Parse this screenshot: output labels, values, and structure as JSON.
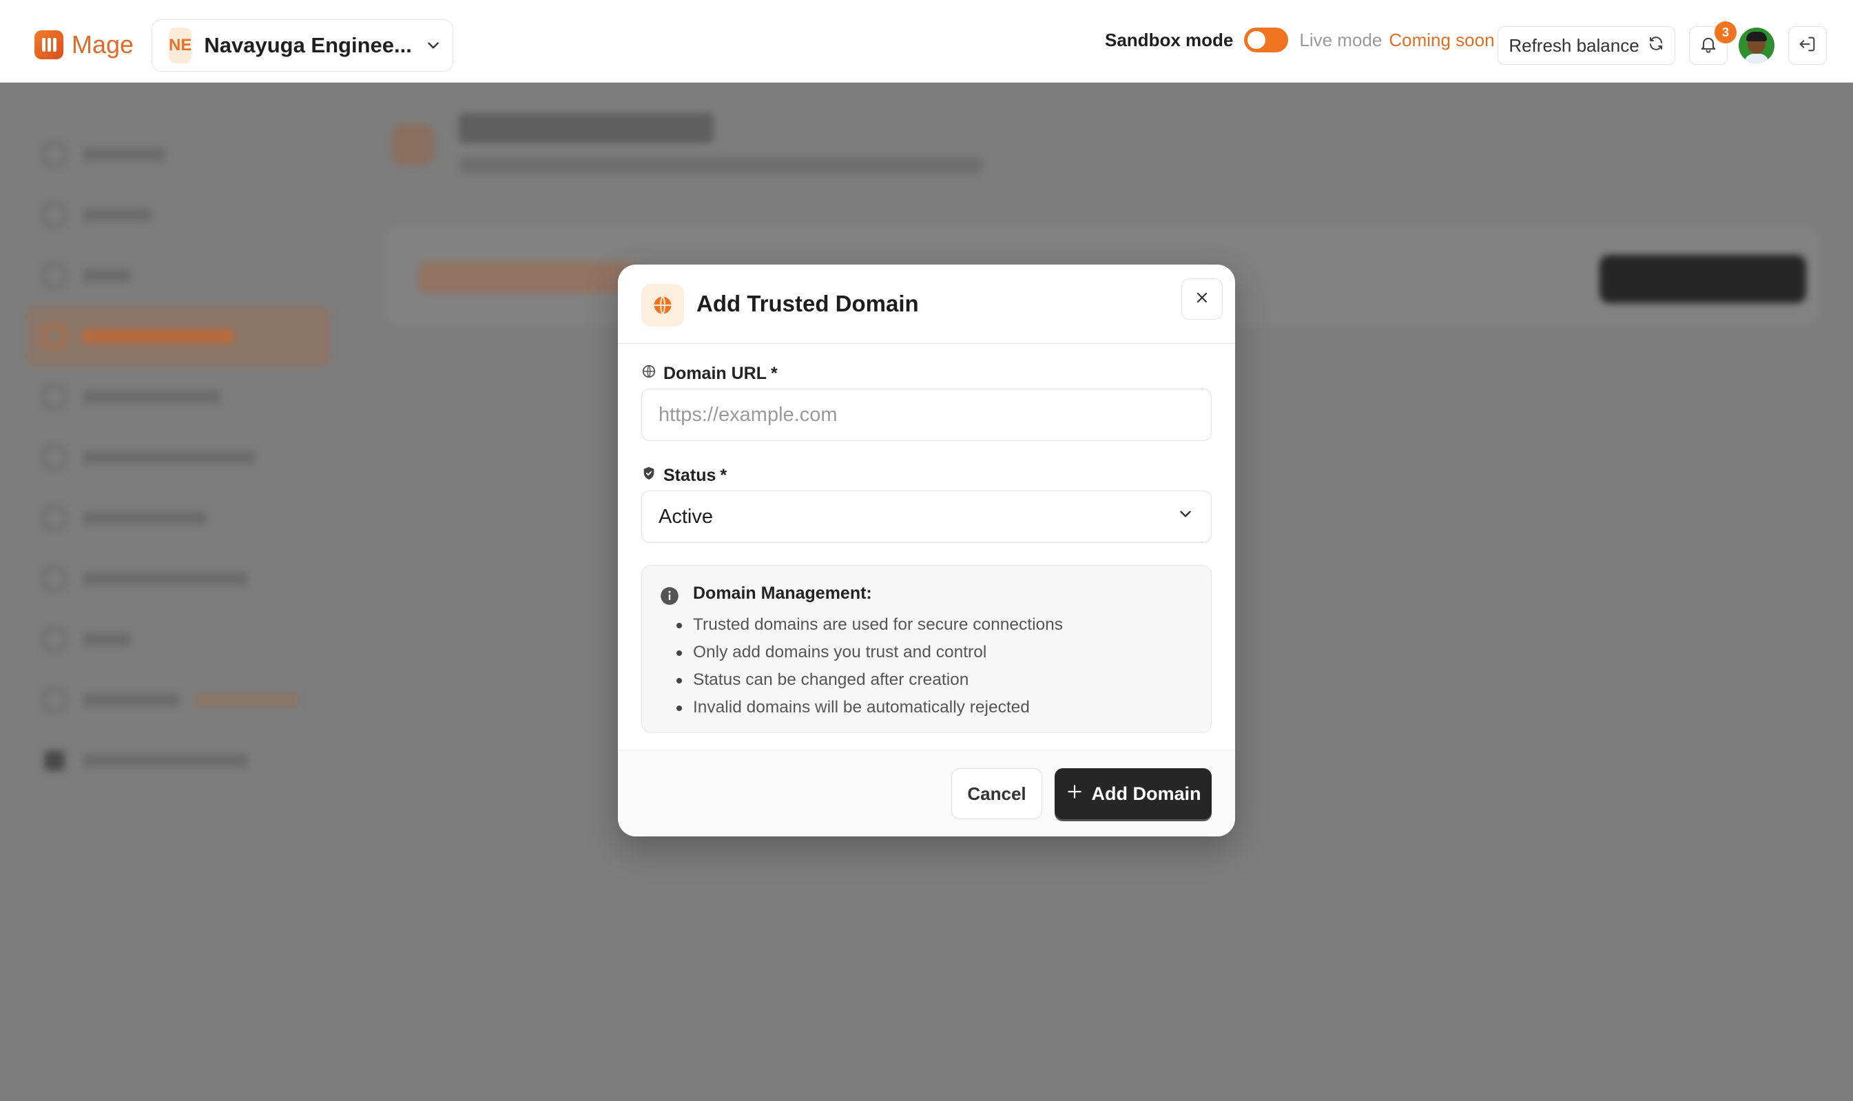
{
  "topbar": {
    "brand": "Mage",
    "org": {
      "initials": "NE",
      "name": "Navayuga Enginee..."
    },
    "sandbox_label": "Sandbox mode",
    "live_label": "Live mode",
    "coming_soon": "Coming soon",
    "refresh_label": "Refresh balance",
    "notification_count": "3",
    "accent_color": "#f07320"
  },
  "modal": {
    "title": "Add Trusted Domain",
    "domain_label": "Domain URL",
    "domain_required": "*",
    "domain_value": "",
    "domain_placeholder": "https://example.com",
    "status_label": "Status",
    "status_required": "*",
    "status_value": "Active",
    "info": {
      "title": "Domain Management:",
      "items": [
        "Trusted domains are used for secure connections",
        "Only add domains you trust and control",
        "Status can be changed after creation",
        "Invalid domains will be automatically rejected"
      ]
    },
    "cancel_label": "Cancel",
    "submit_label": "Add Domain"
  },
  "icons": [
    "app-logo-icon",
    "chevron-down-icon",
    "refresh-icon",
    "bell-icon",
    "logout-icon",
    "globe-icon",
    "close-icon",
    "shield-icon",
    "info-icon",
    "plus-icon"
  ]
}
